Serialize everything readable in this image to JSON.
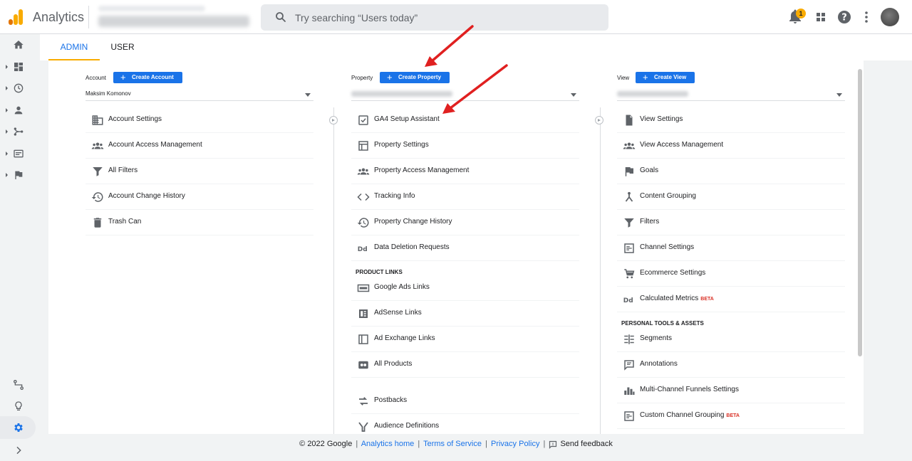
{
  "app": {
    "title": "Analytics"
  },
  "search": {
    "placeholder": "Try searching “Users today”"
  },
  "header": {
    "notification_count": "1"
  },
  "tabs": [
    {
      "label": "ADMIN"
    },
    {
      "label": "USER"
    }
  ],
  "account": {
    "label": "Account",
    "create_label": "Create Account",
    "selected": "Maksim Komonov",
    "items": [
      {
        "label": "Account Settings",
        "icon": "building-icon"
      },
      {
        "label": "Account Access Management",
        "icon": "people-icon"
      },
      {
        "label": "All Filters",
        "icon": "filter-icon"
      },
      {
        "label": "Account Change History",
        "icon": "history-icon"
      },
      {
        "label": "Trash Can",
        "icon": "trash-icon"
      }
    ]
  },
  "property": {
    "label": "Property",
    "create_label": "Create Property",
    "items": [
      {
        "label": "GA4 Setup Assistant",
        "icon": "checkbox-icon"
      },
      {
        "label": "Property Settings",
        "icon": "layout-icon"
      },
      {
        "label": "Property Access Management",
        "icon": "people-icon"
      },
      {
        "label": "Tracking Info",
        "icon": "code-icon"
      },
      {
        "label": "Property Change History",
        "icon": "history-icon"
      },
      {
        "label": "Data Deletion Requests",
        "icon": "dd-icon"
      }
    ],
    "product_links_heading": "PRODUCT LINKS",
    "product_links": [
      {
        "label": "Google Ads Links",
        "icon": "ads-icon"
      },
      {
        "label": "AdSense Links",
        "icon": "adsense-icon"
      },
      {
        "label": "Ad Exchange Links",
        "icon": "adexchange-icon"
      },
      {
        "label": "All Products",
        "icon": "products-icon"
      }
    ],
    "more_items": [
      {
        "label": "Postbacks",
        "icon": "postbacks-icon"
      },
      {
        "label": "Audience Definitions",
        "icon": "audience-icon"
      }
    ]
  },
  "view": {
    "label": "View",
    "create_label": "Create View",
    "items": [
      {
        "label": "View Settings",
        "icon": "document-icon"
      },
      {
        "label": "View Access Management",
        "icon": "people-icon"
      },
      {
        "label": "Goals",
        "icon": "flag-icon"
      },
      {
        "label": "Content Grouping",
        "icon": "grouping-icon"
      },
      {
        "label": "Filters",
        "icon": "filter-icon"
      },
      {
        "label": "Channel Settings",
        "icon": "channel-icon"
      },
      {
        "label": "Ecommerce Settings",
        "icon": "cart-icon"
      },
      {
        "label": "Calculated Metrics",
        "icon": "dd-icon",
        "badge": "BETA"
      }
    ],
    "tools_heading": "PERSONAL TOOLS & ASSETS",
    "tools": [
      {
        "label": "Segments",
        "icon": "segments-icon"
      },
      {
        "label": "Annotations",
        "icon": "annotation-icon"
      },
      {
        "label": "Multi-Channel Funnels Settings",
        "icon": "bar-chart-icon"
      },
      {
        "label": "Custom Channel Grouping",
        "icon": "channel-icon",
        "badge": "BETA"
      }
    ]
  },
  "footer": {
    "copyright": "© 2022 Google",
    "links": [
      "Analytics home",
      "Terms of Service",
      "Privacy Policy"
    ],
    "feedback": "Send feedback"
  },
  "colors": {
    "accent": "#1a73e8",
    "tab_indicator": "#f9ab00",
    "annotation_arrow": "#e02020"
  }
}
